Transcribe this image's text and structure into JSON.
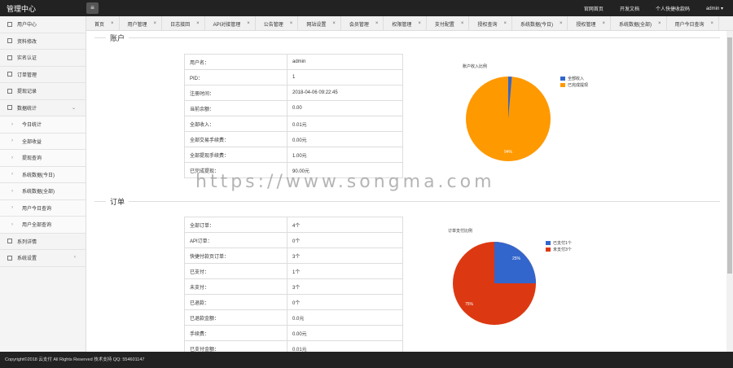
{
  "header": {
    "brand": "管理中心",
    "menu_icon": "menu-icon",
    "links": [
      "官网首页",
      "开发文档",
      "个人快捷收款码",
      "admin ▾"
    ]
  },
  "sidebar": {
    "items": [
      {
        "label": "用户中心",
        "sub": false
      },
      {
        "label": "资料修改",
        "sub": false
      },
      {
        "label": "实名认证",
        "sub": false
      },
      {
        "label": "订单管理",
        "sub": false
      },
      {
        "label": "提现记录",
        "sub": false
      },
      {
        "label": "数据统计",
        "sub": false,
        "arrow": "⌄"
      },
      {
        "label": "今日统计",
        "sub": true
      },
      {
        "label": "全部收益",
        "sub": true
      },
      {
        "label": "提现查询",
        "sub": true
      },
      {
        "label": "系统数据(今日)",
        "sub": true
      },
      {
        "label": "系统数据(全部)",
        "sub": true
      },
      {
        "label": "用户今日查询",
        "sub": true
      },
      {
        "label": "用户全部查询",
        "sub": true
      },
      {
        "label": "系列详情",
        "sub": false
      },
      {
        "label": "系统设置",
        "sub": false,
        "arrow": "‹"
      }
    ]
  },
  "tabs": [
    "首页",
    "用户管理",
    "日志接回",
    "API对接管理",
    "公告管理",
    "网站设置",
    "会员管理",
    "权限管理",
    "支付配置",
    "授权查询",
    "系统数据(今日)",
    "授权管理",
    "系统数据(全部)",
    "用户今日查询"
  ],
  "account": {
    "title": "账户",
    "rows": [
      {
        "k": "用户名：",
        "v": "admin"
      },
      {
        "k": "PID：",
        "v": "1"
      },
      {
        "k": "注册时间：",
        "v": "2018-04-06 09:22:45"
      },
      {
        "k": "当前余额：",
        "v": "0.00"
      },
      {
        "k": "全部收入：",
        "v": "0.01元"
      },
      {
        "k": "全部交易手续费：",
        "v": "0.00元"
      },
      {
        "k": "全部提现手续费：",
        "v": "1.00元"
      },
      {
        "k": "已完成提现：",
        "v": "90.00元"
      }
    ],
    "pie": {
      "title": "账户收入比例",
      "legend": [
        "全部收入",
        "已完成提现"
      ],
      "colors": [
        "#3366cc",
        "#ff9900"
      ],
      "label": "94%"
    }
  },
  "orders": {
    "title": "订单",
    "rows": [
      {
        "k": "全部订单：",
        "v": "4个"
      },
      {
        "k": "API订单：",
        "v": "0个"
      },
      {
        "k": "快捷付款页订单：",
        "v": "3个"
      },
      {
        "k": "已支付：",
        "v": "1个"
      },
      {
        "k": "未支付：",
        "v": "3个"
      },
      {
        "k": "已退款：",
        "v": "0个"
      },
      {
        "k": "已退款金额：",
        "v": "0.0元"
      },
      {
        "k": "手续费：",
        "v": "0.00元"
      },
      {
        "k": "已支付金额：",
        "v": "0.01元"
      }
    ],
    "pie": {
      "title": "订单支付比例",
      "legend": [
        "已支付1个",
        "未支付3个"
      ],
      "colors": [
        "#3366cc",
        "#dc3912"
      ],
      "labels": [
        "25%",
        "75%"
      ]
    }
  },
  "watermark": "https://www.songma.com",
  "footer": "Copyright©2018 云支付 All Rights Reserved   技术支持 QQ: 554601147"
}
